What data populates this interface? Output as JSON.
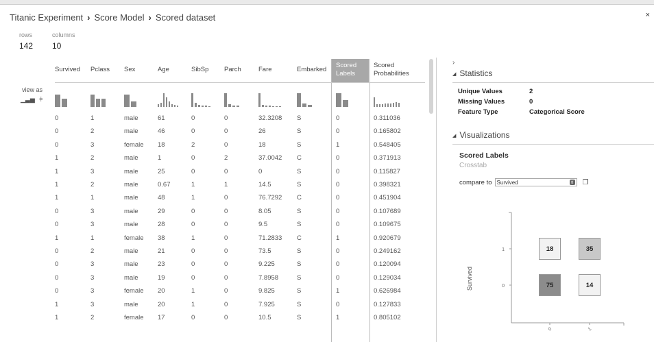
{
  "breadcrumb": [
    "Titanic Experiment",
    "Score Model",
    "Scored dataset"
  ],
  "close_label": "×",
  "meta": {
    "rows_label": "rows",
    "rows": "142",
    "columns_label": "columns",
    "columns": "10"
  },
  "view_as_label": "view as",
  "columns": [
    {
      "line1": "Survived",
      "line2": ""
    },
    {
      "line1": "Pclass",
      "line2": ""
    },
    {
      "line1": "Sex",
      "line2": ""
    },
    {
      "line1": "Age",
      "line2": ""
    },
    {
      "line1": "SibSp",
      "line2": ""
    },
    {
      "line1": "Parch",
      "line2": ""
    },
    {
      "line1": "Fare",
      "line2": ""
    },
    {
      "line1": "Embarked",
      "line2": ""
    },
    {
      "line1": "Scored",
      "line2": "Labels"
    },
    {
      "line1": "Scored",
      "line2": "Probabilities"
    }
  ],
  "rows": [
    [
      "0",
      "1",
      "male",
      "61",
      "0",
      "0",
      "32.3208",
      "S",
      "0",
      "0.311036"
    ],
    [
      "0",
      "2",
      "male",
      "46",
      "0",
      "0",
      "26",
      "S",
      "0",
      "0.165802"
    ],
    [
      "0",
      "3",
      "female",
      "18",
      "2",
      "0",
      "18",
      "S",
      "1",
      "0.548405"
    ],
    [
      "1",
      "2",
      "male",
      "1",
      "0",
      "2",
      "37.0042",
      "C",
      "0",
      "0.371913"
    ],
    [
      "1",
      "3",
      "male",
      "25",
      "0",
      "0",
      "0",
      "S",
      "0",
      "0.115827"
    ],
    [
      "1",
      "2",
      "male",
      "0.67",
      "1",
      "1",
      "14.5",
      "S",
      "0",
      "0.398321"
    ],
    [
      "1",
      "1",
      "male",
      "48",
      "1",
      "0",
      "76.7292",
      "C",
      "0",
      "0.451904"
    ],
    [
      "0",
      "3",
      "male",
      "29",
      "0",
      "0",
      "8.05",
      "S",
      "0",
      "0.107689"
    ],
    [
      "0",
      "3",
      "male",
      "28",
      "0",
      "0",
      "9.5",
      "S",
      "0",
      "0.109675"
    ],
    [
      "1",
      "1",
      "female",
      "38",
      "1",
      "0",
      "71.2833",
      "C",
      "1",
      "0.920679"
    ],
    [
      "0",
      "2",
      "male",
      "21",
      "0",
      "0",
      "73.5",
      "S",
      "0",
      "0.249162"
    ],
    [
      "0",
      "3",
      "male",
      "23",
      "0",
      "0",
      "9.225",
      "S",
      "0",
      "0.120094"
    ],
    [
      "0",
      "3",
      "male",
      "19",
      "0",
      "0",
      "7.8958",
      "S",
      "0",
      "0.129034"
    ],
    [
      "0",
      "3",
      "female",
      "20",
      "1",
      "0",
      "9.825",
      "S",
      "1",
      "0.626984"
    ],
    [
      "1",
      "3",
      "male",
      "20",
      "1",
      "0",
      "7.925",
      "S",
      "0",
      "0.127833"
    ],
    [
      "1",
      "2",
      "female",
      "17",
      "0",
      "0",
      "10.5",
      "S",
      "1",
      "0.805102"
    ]
  ],
  "panel": {
    "chevron": "›",
    "statistics_title": "Statistics",
    "stats": [
      {
        "label": "Unique Values",
        "value": "2"
      },
      {
        "label": "Missing Values",
        "value": "0"
      },
      {
        "label": "Feature Type",
        "value": "Categorical Score"
      }
    ],
    "visualizations_title": "Visualizations",
    "viz_title": "Scored Labels",
    "viz_subtitle": "Crosstab",
    "compare_label": "compare to",
    "compare_value": "Survived"
  },
  "chart_data": {
    "type": "heatmap",
    "title": "Scored Labels",
    "subtitle": "Crosstab",
    "ylabel": "Survived",
    "xlabel": "",
    "x_categories": [
      "0",
      "1"
    ],
    "y_categories": [
      "0",
      "1"
    ],
    "cells": [
      {
        "x": "0",
        "y": "1",
        "value": 18
      },
      {
        "x": "1",
        "y": "1",
        "value": 35
      },
      {
        "x": "0",
        "y": "0",
        "value": 75
      },
      {
        "x": "1",
        "y": "0",
        "value": 14
      }
    ],
    "colors": {
      "low": "#f2f2f2",
      "mid": "#c8c8c8",
      "high": "#8c8c8c"
    }
  }
}
